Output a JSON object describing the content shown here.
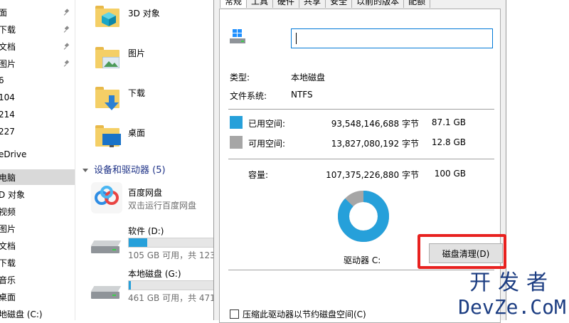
{
  "nav": {
    "items": [
      {
        "label": "面",
        "pinned": true,
        "selected": false
      },
      {
        "label": "下载",
        "pinned": true,
        "selected": false
      },
      {
        "label": "文档",
        "pinned": true,
        "selected": false
      },
      {
        "label": "图片",
        "pinned": true,
        "selected": false
      },
      {
        "label": "6",
        "pinned": false,
        "selected": false
      },
      {
        "label": "104",
        "pinned": false,
        "selected": false
      },
      {
        "label": "214",
        "pinned": false,
        "selected": false
      },
      {
        "label": "227",
        "pinned": false,
        "selected": false
      },
      {
        "label": "eDrive",
        "pinned": false,
        "selected": false
      },
      {
        "label": "电脑",
        "pinned": false,
        "selected": true
      },
      {
        "label": "D 对象",
        "pinned": false,
        "selected": false
      },
      {
        "label": "视频",
        "pinned": false,
        "selected": false
      },
      {
        "label": "图片",
        "pinned": false,
        "selected": false
      },
      {
        "label": "文档",
        "pinned": false,
        "selected": false
      },
      {
        "label": "下载",
        "pinned": false,
        "selected": false
      },
      {
        "label": "音乐",
        "pinned": false,
        "selected": false
      },
      {
        "label": "桌面",
        "pinned": false,
        "selected": false
      },
      {
        "label": "地磁盘 (C:)",
        "pinned": false,
        "selected": false
      }
    ]
  },
  "folders": [
    {
      "label": "3D 对象",
      "icon": "3d-objects-icon"
    },
    {
      "label": "图片",
      "icon": "pictures-folder-icon"
    },
    {
      "label": "下载",
      "icon": "downloads-folder-icon"
    },
    {
      "label": "桌面",
      "icon": "desktop-folder-icon"
    }
  ],
  "devices": {
    "header": "设备和驱动器 (5)",
    "baidu": {
      "name": "百度网盘",
      "sub": "双击运行百度网盘"
    },
    "drives": [
      {
        "name": "软件 (D:)",
        "free": "105 GB 可用，共 123",
        "used_fraction": 0.2
      },
      {
        "name": "本地磁盘 (G:)",
        "free": "461 GB 可用，共 471",
        "used_fraction": 0.02
      }
    ]
  },
  "dialog": {
    "tabs": [
      {
        "label": "常规",
        "active": true
      },
      {
        "label": "工具",
        "active": false
      },
      {
        "label": "硬件",
        "active": false
      },
      {
        "label": "共享",
        "active": false
      },
      {
        "label": "安全",
        "active": false
      },
      {
        "label": "以前的版本",
        "active": false
      },
      {
        "label": "配额",
        "active": false
      }
    ],
    "name_value": "",
    "type_label": "类型:",
    "type_value": "本地磁盘",
    "fs_label": "文件系统:",
    "fs_value": "NTFS",
    "used": {
      "label": "已用空间:",
      "bytes": "93,548,146,688 字节",
      "gb": "87.1 GB",
      "color": "#26a0da"
    },
    "free": {
      "label": "可用空间:",
      "bytes": "13,827,080,192 字节",
      "gb": "12.8 GB",
      "color": "#a6a6a6"
    },
    "capacity": {
      "label": "容量:",
      "bytes": "107,375,226,880 字节",
      "gb": "100 GB"
    },
    "drive_label": "驱动器 C:",
    "used_fraction": 0.871,
    "cleanup_button": "磁盘清理(D)",
    "compress_label": "压缩此驱动器以节约磁盘空间(C)",
    "highlight_color": "#e8211f"
  },
  "watermark": {
    "cn": "开发者",
    "en": "DevZe.CoM"
  }
}
